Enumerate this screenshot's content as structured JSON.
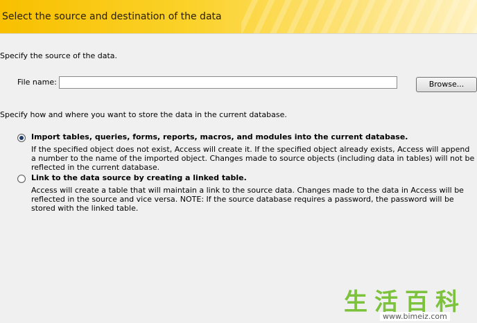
{
  "header": {
    "title": "Select the source and destination of the data"
  },
  "source": {
    "instruction": "Specify the source of the data.",
    "file_name_label": "File name:",
    "file_name_value": "",
    "browse_label": "Browse..."
  },
  "storage": {
    "instruction": "Specify how and where you want to store the data in the current database.",
    "options": [
      {
        "label": "Import tables, queries, forms, reports, macros, and modules into the current database.",
        "description": "If the specified object does not exist, Access will create it. If the specified object already exists, Access will append a number to the name of the imported object. Changes made to source objects (including data in tables) will not be reflected in the current database.",
        "selected": true
      },
      {
        "label": "Link to the data source by creating a linked table.",
        "description": "Access will create a table that will maintain a link to the source data. Changes made to the data in Access will be reflected in the source and vice versa. NOTE:  If the source database requires a password, the password will be stored with the linked table.",
        "selected": false
      }
    ]
  },
  "watermark": {
    "chars": "生活百科",
    "url": "www.bimeiz.com"
  },
  "colors": {
    "header_yellow": "#f8c000",
    "radio_dot": "#1f3c6b",
    "watermark_green": "#7cc23d"
  }
}
